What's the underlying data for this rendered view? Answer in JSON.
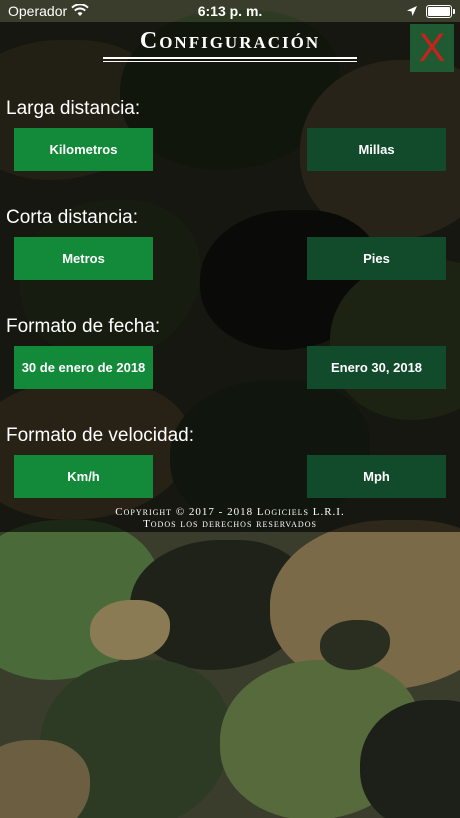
{
  "status_bar": {
    "carrier": "Operador",
    "time": "6:13 p. m."
  },
  "header": {
    "title": "Configuración",
    "close_label": "X"
  },
  "sections": [
    {
      "label": "Larga distancia:",
      "option_left": "Kilometros",
      "option_right": "Millas"
    },
    {
      "label": "Corta distancia:",
      "option_left": "Metros",
      "option_right": "Pies"
    },
    {
      "label": "Formato de fecha:",
      "option_left": "30 de enero de 2018",
      "option_right": "Enero 30, 2018"
    },
    {
      "label": "Formato de velocidad:",
      "option_left": "Km/h",
      "option_right": "Mph"
    }
  ],
  "footer": {
    "line1": "Copyright © 2017 - 2018 Logiciels L.R.I.",
    "line2": "Todos los derechos reservados"
  },
  "colors": {
    "selected_button": "#13893a",
    "unselected_button": "#124b2c",
    "close_button_bg": "#1f5a32",
    "close_x": "#c8221d"
  }
}
